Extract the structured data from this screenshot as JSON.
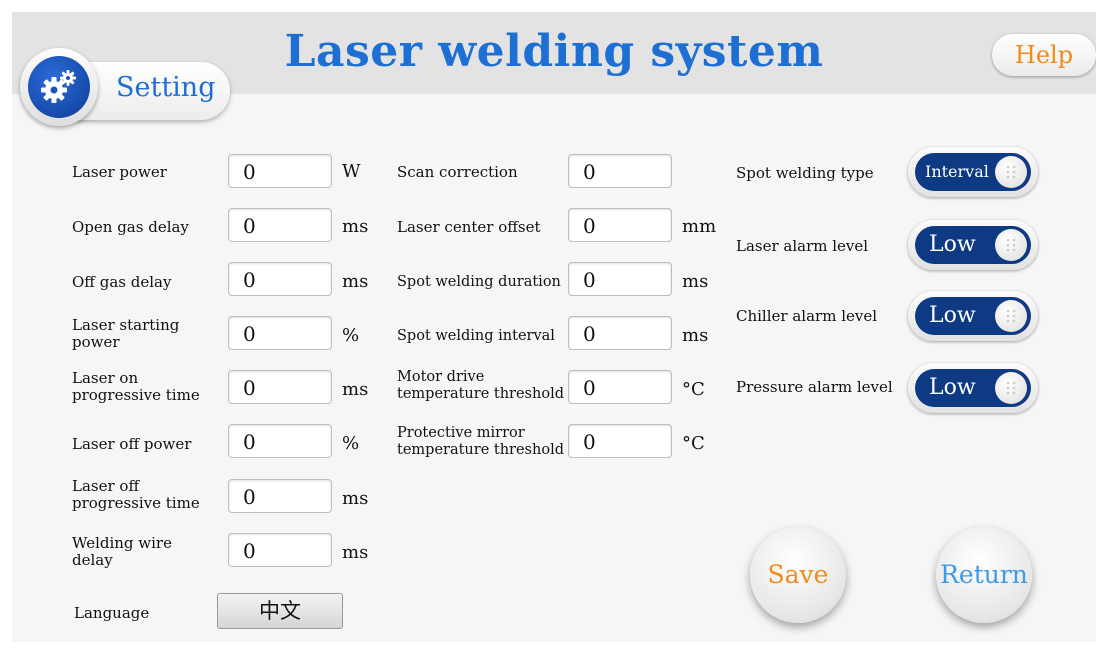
{
  "header": {
    "title": "Laser welding system",
    "help_label": "Help",
    "setting_label": "Setting"
  },
  "col1": [
    {
      "label": "Laser power",
      "value": "0",
      "unit": "W"
    },
    {
      "label": "Open gas delay",
      "value": "0",
      "unit": "ms"
    },
    {
      "label": "Off gas delay",
      "value": "0",
      "unit": "ms"
    },
    {
      "label": "Laser starting power",
      "value": "0",
      "unit": "%"
    },
    {
      "label": "Laser on progressive time",
      "value": "0",
      "unit": "ms"
    },
    {
      "label": "Laser off power",
      "value": "0",
      "unit": "%"
    },
    {
      "label": "Laser off progressive time",
      "value": "0",
      "unit": "ms"
    },
    {
      "label": "Welding wire delay",
      "value": "0",
      "unit": "ms"
    }
  ],
  "language": {
    "label": "Language",
    "value": "中文"
  },
  "col2": [
    {
      "label": "Scan correction",
      "value": "0",
      "unit": ""
    },
    {
      "label": "Laser center offset",
      "value": "0",
      "unit": "mm"
    },
    {
      "label": "Spot welding duration",
      "value": "0",
      "unit": "ms"
    },
    {
      "label": "Spot welding interval",
      "value": "0",
      "unit": "ms"
    },
    {
      "label": "Motor drive temperature threshold",
      "value": "0",
      "unit": "°C"
    },
    {
      "label": "Protective mirror temperature threshold",
      "value": "0",
      "unit": "°C"
    }
  ],
  "toggles": [
    {
      "label": "Spot welding type",
      "value": "Interval"
    },
    {
      "label": "Laser alarm level",
      "value": "Low"
    },
    {
      "label": "Chiller alarm level",
      "value": "Low"
    },
    {
      "label": "Pressure alarm level",
      "value": "Low"
    }
  ],
  "buttons": {
    "save_label": "Save",
    "return_label": "Return"
  },
  "colors": {
    "title": "#1e6fd3",
    "accent_orange": "#ef8a1d",
    "toggle_track": "#0d3a82",
    "return_blue": "#3b9be8"
  }
}
